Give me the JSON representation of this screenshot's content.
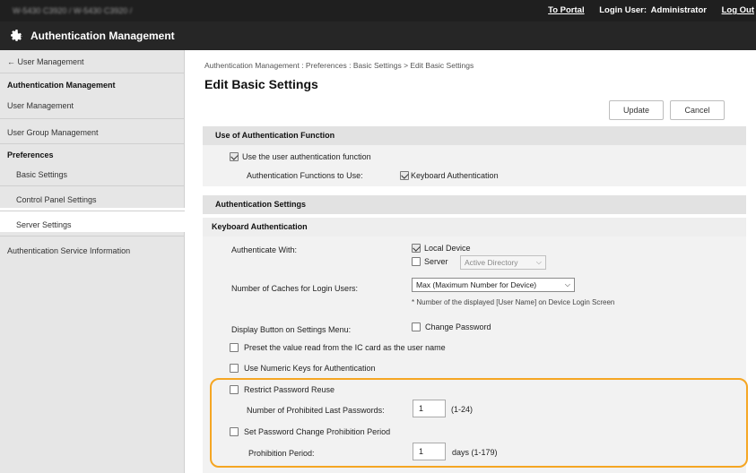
{
  "topbar": {
    "device": "W-5430  C3920 / W-5430  C3920 /",
    "to_portal": "To Portal",
    "login_user_label": "Login User:",
    "login_user": "Administrator",
    "logout": "Log Out"
  },
  "app": {
    "title": "Authentication Management",
    "icon": "gear-icon"
  },
  "sidebar": {
    "back": "← User Management",
    "section1": "Authentication Management",
    "items1": [
      "User Management",
      "User Group Management"
    ],
    "section2": "Preferences",
    "sub_items": [
      "Basic Settings",
      "Control Panel Settings",
      "Server Settings"
    ],
    "item_last": "Authentication Service Information"
  },
  "main": {
    "breadcrumb": "Authentication Management : Preferences : Basic Settings > Edit Basic Settings",
    "title": "Edit Basic Settings",
    "update_button": "Update",
    "cancel_button": "Cancel"
  },
  "use_auth": {
    "header": "Use of Authentication Function",
    "use_user_auth": "Use the user authentication function",
    "functions_label": "Authentication Functions to Use:",
    "keyboard_auth": "Keyboard Authentication"
  },
  "auth_settings": {
    "header": "Authentication Settings",
    "sub_header": "Keyboard Authentication",
    "authenticate_with_label": "Authenticate With:",
    "local_device": "Local Device",
    "server": "Server",
    "server_type": "Active Directory",
    "caches_label": "Number of Caches for Login Users:",
    "caches_value": "Max (Maximum Number for Device)",
    "caches_note": "* Number of the displayed [User Name] on Device Login Screen",
    "display_button_label": "Display Button on Settings Menu:",
    "change_password": "Change Password",
    "preset_ic": "Preset the value read from the IC card as the user name",
    "numeric_keys": "Use Numeric Keys for Authentication",
    "restrict_reuse": "Restrict Password Reuse",
    "prohibited_label": "Number of Prohibited Last Passwords:",
    "prohibited_value": "1",
    "prohibited_range": "(1-24)",
    "set_prohibition": "Set Password Change Prohibition Period",
    "period_label": "Prohibition Period:",
    "period_value": "1",
    "period_range": "days (1-179)"
  },
  "colors": {
    "highlight": "#f5a623",
    "topbar": "#1f1f1f",
    "sidebar": "#e6e6e6"
  }
}
